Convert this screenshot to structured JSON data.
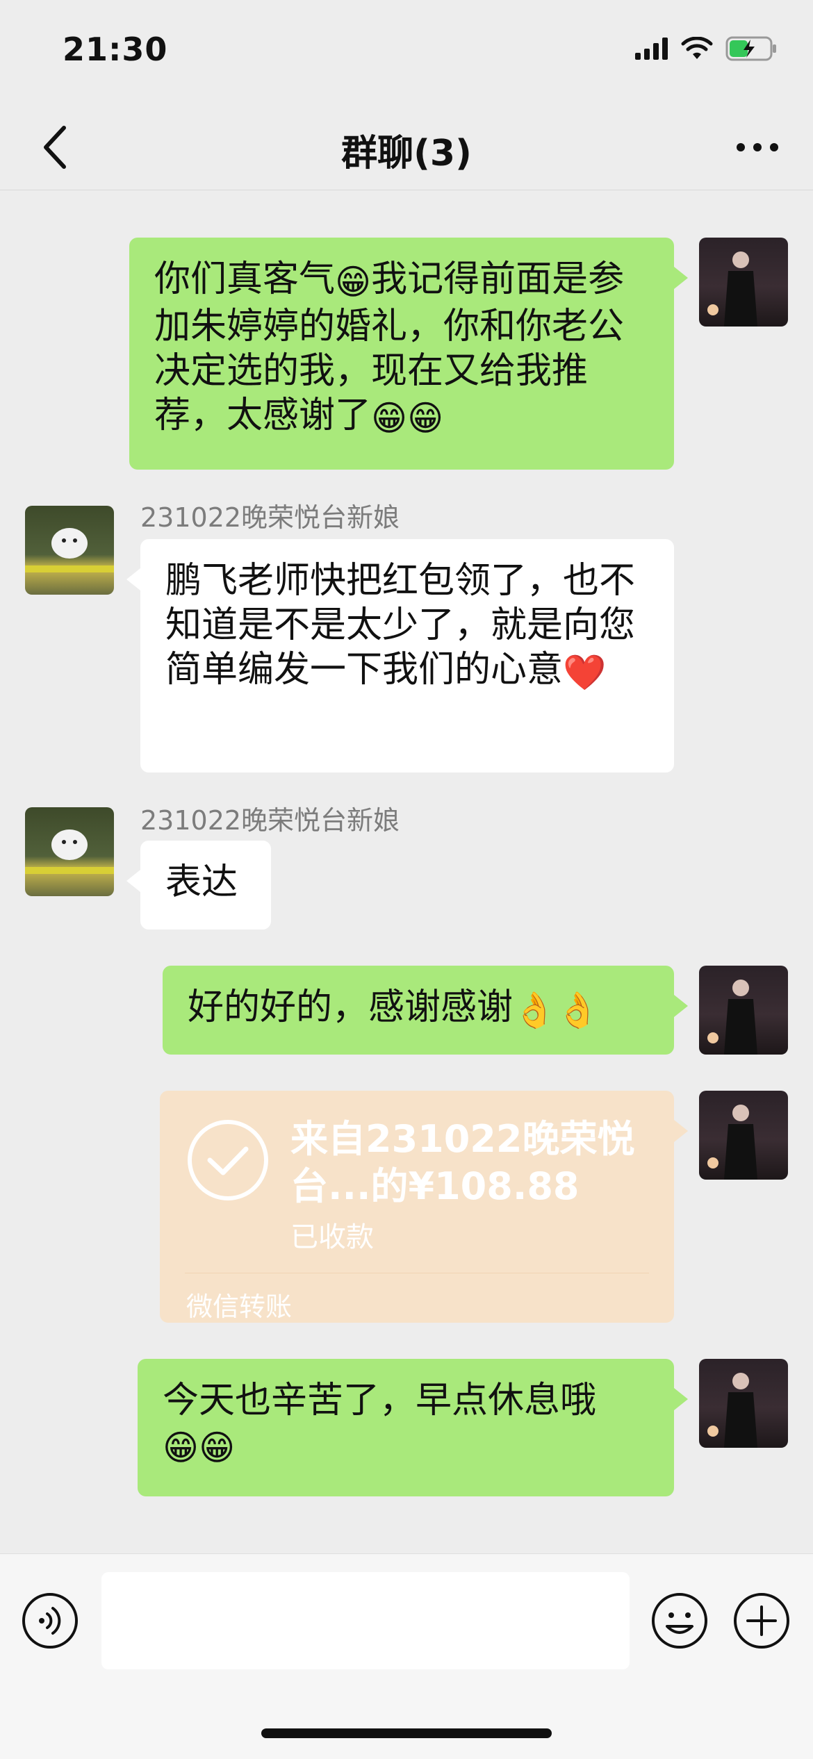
{
  "status": {
    "time": "21:30"
  },
  "nav": {
    "title": "群聊(3)"
  },
  "messages": [
    {
      "id": "m1",
      "sender": "me",
      "text_parts": [
        "你们真客气",
        "😁",
        "我记得前面是参加朱婷婷的婚礼，你和你老公决定选的我，现在又给我推荐，太感谢了",
        "😁😁"
      ]
    },
    {
      "id": "m2",
      "sender": "231022晚荣悦台新娘",
      "text_parts": [
        "鹏飞老师快把红包领了，也不知道是不是太少了，就是向您简单编发一下我们的心意",
        "❤️"
      ]
    },
    {
      "id": "m3",
      "sender": "231022晚荣悦台新娘",
      "text": "表达"
    },
    {
      "id": "m4",
      "sender": "me",
      "text_parts": [
        "好的好的，感谢感谢",
        "👌👌"
      ]
    },
    {
      "id": "m5",
      "sender": "me",
      "type": "transfer",
      "amount_text": "来自231022晚荣悦台...的¥108.88",
      "status": "已收款",
      "footer": "微信转账"
    },
    {
      "id": "m6",
      "sender": "me",
      "text_parts": [
        "今天也辛苦了，早点休息哦",
        "😁😁"
      ]
    }
  ],
  "input": {
    "value": ""
  },
  "colors": {
    "bubble_green": "#a9e97b",
    "transfer_bg": "#f7e2c9",
    "background": "#ededed"
  }
}
